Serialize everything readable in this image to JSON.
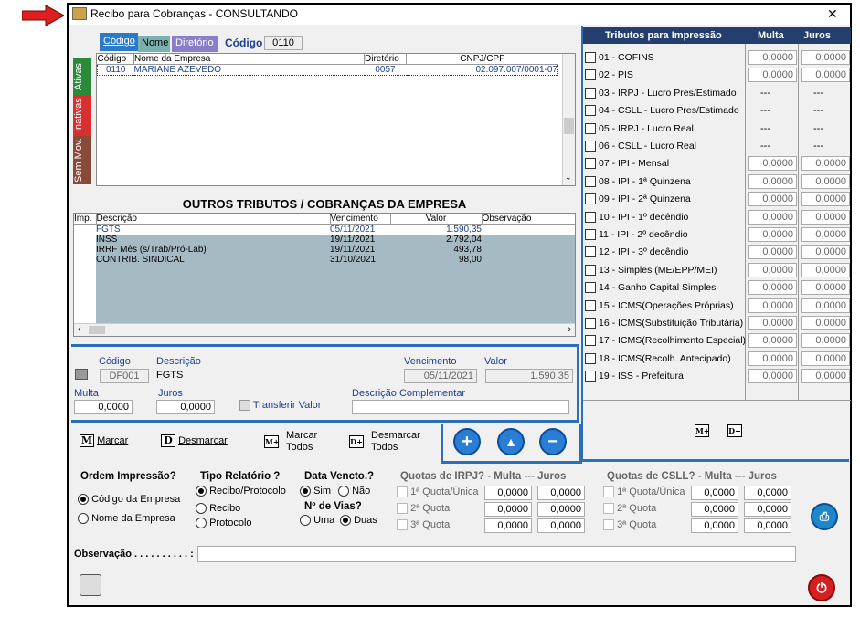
{
  "window": {
    "title": "Recibo para Cobranças - CONSULTANDO",
    "close": "✕"
  },
  "tabs": {
    "codigo": "Código",
    "nome": "Nome",
    "diretorio": "Diretório",
    "filter_label": "Código",
    "filter_value": "0110"
  },
  "side_tabs": {
    "ativas": "Ativas",
    "inativas": "Inativas",
    "sem_mov": "Sem Mov."
  },
  "companies": {
    "headers": [
      "Código",
      "Nome da Empresa",
      "Diretório",
      "CNPJ/CPF"
    ],
    "rows": [
      [
        "0110",
        "MARIANE AZEVEDO",
        "0057",
        "02.097.007/0001-07"
      ]
    ]
  },
  "outros": {
    "title": "OUTROS  TRIBUTOS / COBRANÇAS  DA  EMPRESA",
    "headers": [
      "Imp.",
      "Descrição",
      "Vencimento",
      "Valor",
      "Observação"
    ],
    "rows": [
      [
        "FGTS",
        "05/11/2021",
        "1.590,35"
      ],
      [
        "INSS",
        "19/11/2021",
        "2.792,04"
      ],
      [
        "IRRF Mês (s/Trab/Pró-Lab)",
        "19/11/2021",
        "493,78"
      ],
      [
        "CONTRIB. SINDICAL",
        "31/10/2021",
        "98,00"
      ]
    ]
  },
  "detail": {
    "codigo_label": "Código",
    "descricao_label": "Descrição",
    "vencimento_label": "Vencimento",
    "valor_label": "Valor",
    "codigo": "DF001",
    "descricao": "FGTS",
    "vencimento": "05/11/2021",
    "valor": "1.590,35",
    "multa_label": "Multa",
    "juros_label": "Juros",
    "multa": "0,0000",
    "juros": "0,0000",
    "transferir": "Transferir Valor",
    "desc_comp_label": "Descrição Complementar"
  },
  "actions": {
    "marcar": "Marcar",
    "desmarcar": "Desmarcar",
    "marcar_todos": "Marcar\nTodos",
    "desmarcar_todos": "Desmarcar\nTodos",
    "m": "M",
    "d": "D",
    "mt": "M+",
    "dt": "D+"
  },
  "tributos": {
    "header": "Tributos para Impressão",
    "multa": "Multa",
    "juros": "Juros",
    "items": [
      {
        "label": "01 - COFINS",
        "multa": "0,0000",
        "juros": "0,0000"
      },
      {
        "label": "02 - PIS",
        "multa": "0,0000",
        "juros": "0,0000"
      },
      {
        "label": "03 - IRPJ  -  Lucro Pres/Estimado",
        "multa": "---",
        "juros": "---"
      },
      {
        "label": "04 - CSLL - Lucro Pres/Estimado",
        "multa": "---",
        "juros": "---"
      },
      {
        "label": "05 - IRPJ  -  Lucro Real",
        "multa": "---",
        "juros": "---"
      },
      {
        "label": "06 - CSLL - Lucro Real",
        "multa": "---",
        "juros": "---"
      },
      {
        "label": "07 - IPI  -  Mensal",
        "multa": "0,0000",
        "juros": "0,0000"
      },
      {
        "label": "08 - IPI  -  1ª Quinzena",
        "multa": "0,0000",
        "juros": "0,0000"
      },
      {
        "label": "09 - IPI  -  2ª Quinzena",
        "multa": "0,0000",
        "juros": "0,0000"
      },
      {
        "label": "10 - IPI  -  1º decêndio",
        "multa": "0,0000",
        "juros": "0,0000"
      },
      {
        "label": "11 - IPI  -  2º decêndio",
        "multa": "0,0000",
        "juros": "0,0000"
      },
      {
        "label": "12 - IPI  -  3º decêndio",
        "multa": "0,0000",
        "juros": "0,0000"
      },
      {
        "label": "13 - Simples (ME/EPP/MEI)",
        "multa": "0,0000",
        "juros": "0,0000"
      },
      {
        "label": "14 - Ganho Capital Simples",
        "multa": "0,0000",
        "juros": "0,0000"
      },
      {
        "label": "15 - ICMS(Operações Próprias)",
        "multa": "0,0000",
        "juros": "0,0000"
      },
      {
        "label": "16 - ICMS(Substituição Tributária)",
        "multa": "0,0000",
        "juros": "0,0000"
      },
      {
        "label": "17 - ICMS(Recolhimento Especial)",
        "multa": "0,0000",
        "juros": "0,0000"
      },
      {
        "label": "18 - ICMS(Recolh. Antecipado)",
        "multa": "0,0000",
        "juros": "0,0000"
      },
      {
        "label": "19 - ISS - Prefeitura",
        "multa": "0,0000",
        "juros": "0,0000"
      }
    ]
  },
  "bottom": {
    "ordem_title": "Ordem Impressão?",
    "ordem1": "Código da Empresa",
    "ordem2": "Nome da Empresa",
    "tipo_title": "Tipo Relatório ?",
    "tipo1": "Recibo/Protocolo",
    "tipo2": "Recibo",
    "tipo3": "Protocolo",
    "data_title": "Data Vencto.?",
    "sim": "Sim",
    "nao": "Não",
    "vias_title": "Nº de Vias?",
    "uma": "Uma",
    "duas": "Duas",
    "irpj_title": "Quotas de IRPJ? -  Multa  ---  Juros",
    "csll_title": "Quotas de CSLL? - Multa  --- Juros",
    "q1": "1ª Quota/Única",
    "q2": "2ª Quota",
    "q3": "3ª Quota",
    "zero": "0,0000",
    "obs_label": "Observação . . . . . . . . . . :"
  }
}
